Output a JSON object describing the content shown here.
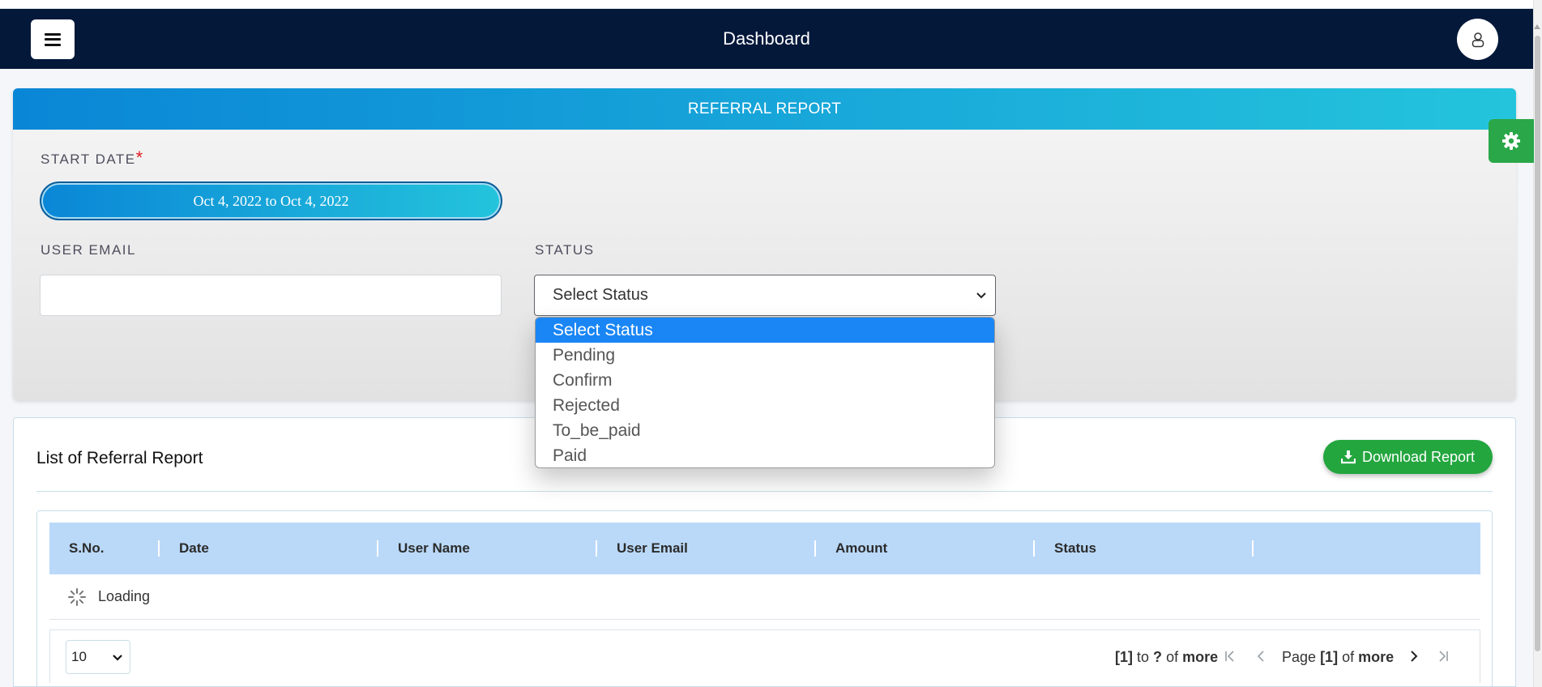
{
  "navbar": {
    "title": "Dashboard",
    "menu_icon": "hamburger-icon",
    "user_icon": "user-icon"
  },
  "filter": {
    "header": "REFERRAL REPORT",
    "start_date_label": "START DATE",
    "required_marker": "*",
    "date_range": "Oct 4, 2022 to Oct 4, 2022",
    "user_email_label": "USER EMAIL",
    "user_email_value": "",
    "status_label": "STATUS",
    "status_selected": "Select Status",
    "status_options": [
      "Select Status",
      "Pending",
      "Confirm",
      "Rejected",
      "To_be_paid",
      "Paid"
    ]
  },
  "settings": {
    "icon": "gear-icon"
  },
  "list": {
    "title": "List of Referral Report",
    "download_label": "Download Report",
    "download_icon": "download-icon",
    "columns": [
      "S.No.",
      "Date",
      "User Name",
      "User Email",
      "Amount",
      "Status"
    ],
    "loading_text": "Loading",
    "page_size": "10",
    "range": {
      "from": "[1]",
      "to_word": "to",
      "to": "?",
      "of_word": "of",
      "total": "more"
    },
    "page": {
      "page_word": "Page",
      "current": "[1]",
      "of_word": "of",
      "total": "more"
    }
  },
  "colors": {
    "navbar": "#04183a",
    "header_gradient_start": "#0a86d6",
    "header_gradient_end": "#24c4dc",
    "selected_option": "#1a86f5",
    "download_button": "#23a63e",
    "table_header": "#bad9f9"
  }
}
